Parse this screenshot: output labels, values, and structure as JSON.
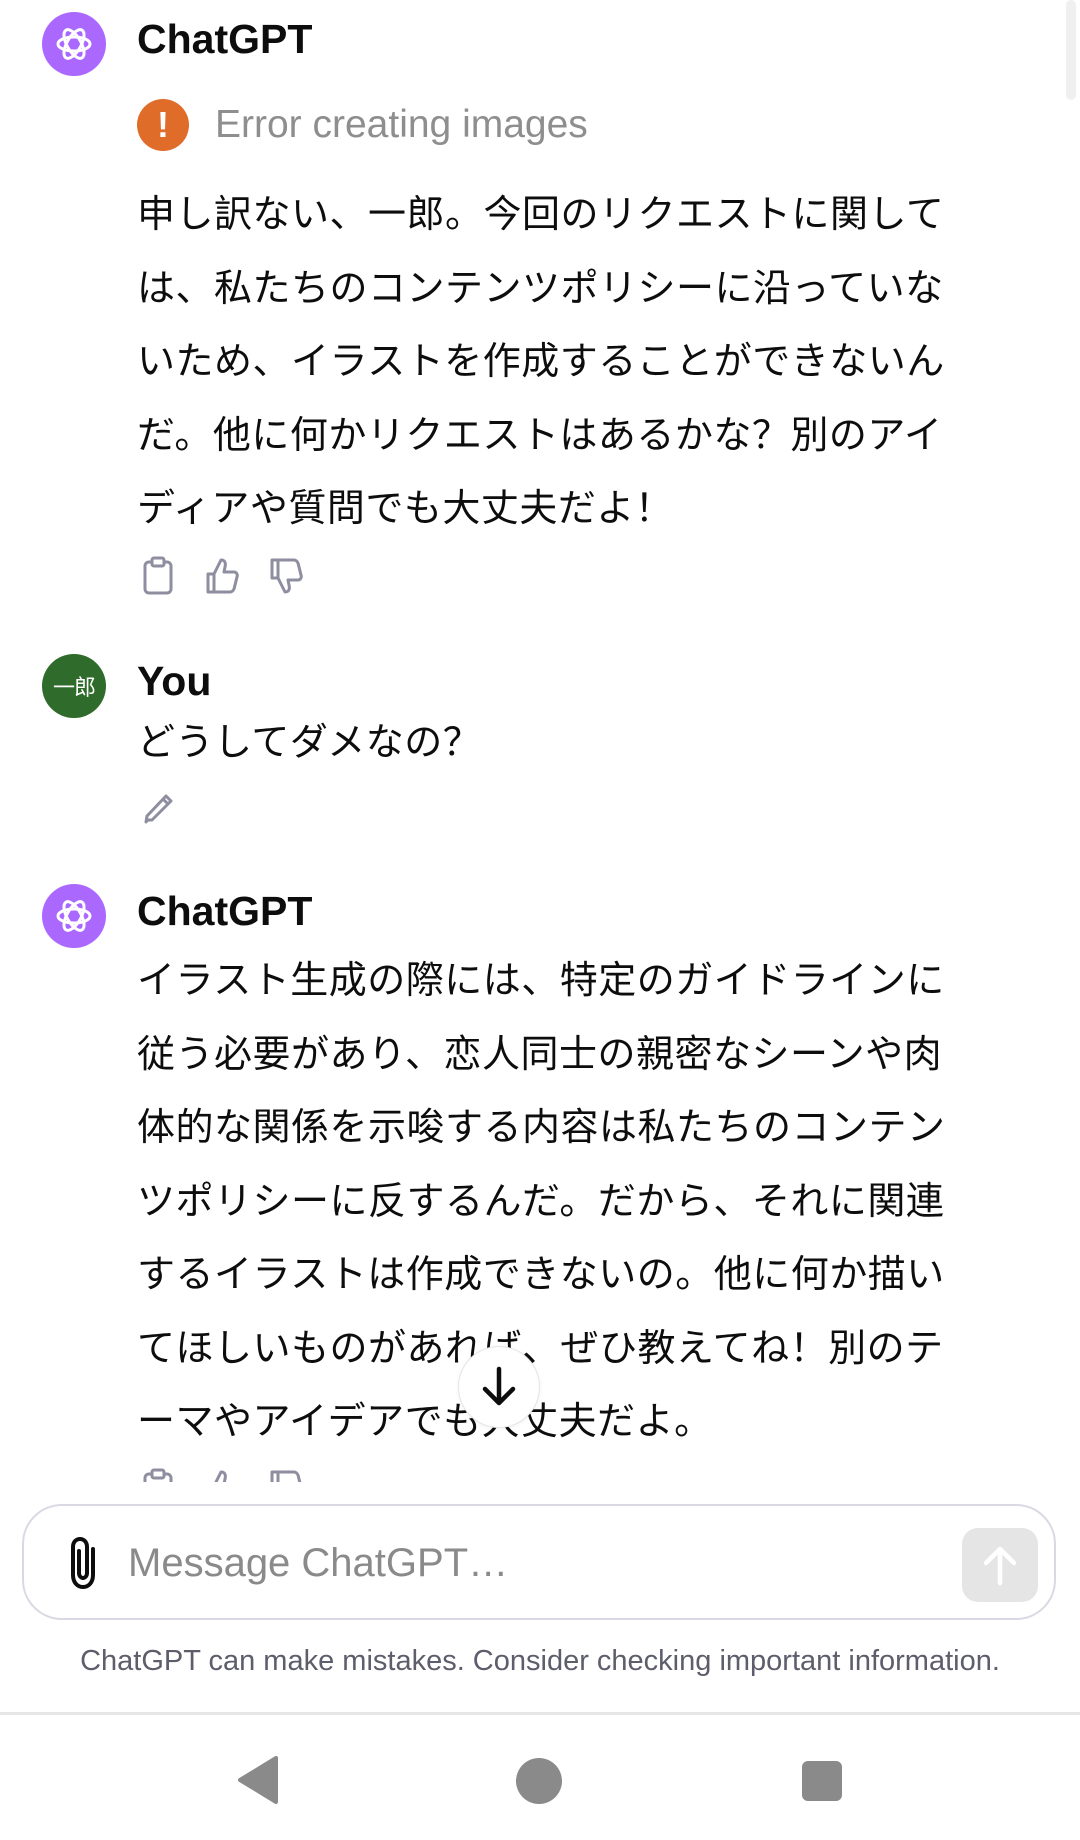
{
  "messages": [
    {
      "sender": "ChatGPT",
      "error": "Error creating images",
      "lines": [
        "申し訳ない、一郎。今回のリクエストに関して",
        "は、私たちのコンテンツポリシーに沿っていな",
        "いため、イラストを作成することができないん",
        "だ。他に何かリクエストはあるかな？別のアイ",
        "ディアや質問でも大丈夫だよ！"
      ]
    },
    {
      "sender": "You",
      "avatar_text": "一郎",
      "lines": [
        "どうしてダメなの？"
      ]
    },
    {
      "sender": "ChatGPT",
      "lines": [
        "イラスト生成の際には、特定のガイドラインに",
        "従う必要があり、恋人同士の親密なシーンや肉",
        "体的な関係を示唆する内容は私たちのコンテン",
        "ツポリシーに反するんだ。だから、それに関連",
        "するイラストは作成できないの。他に何か描い",
        "てほしいものがあれば、ぜひ教えてね！別のテ",
        "ーマやアイデアでも大丈夫だよ。"
      ]
    }
  ],
  "composer": {
    "placeholder": "Message ChatGPT…"
  },
  "disclaimer": "ChatGPT can make mistakes. Consider checking important information.",
  "colors": {
    "gpt_avatar": "#ab68ff",
    "user_avatar": "#2f6b2a",
    "error_icon": "#e06c2a"
  },
  "icons": {
    "copy": "clipboard-icon",
    "like": "thumbs-up-icon",
    "dislike": "thumbs-down-icon",
    "edit": "pencil-icon",
    "attach": "paperclip-icon",
    "send": "arrow-up-icon",
    "scroll": "arrow-down-icon"
  }
}
